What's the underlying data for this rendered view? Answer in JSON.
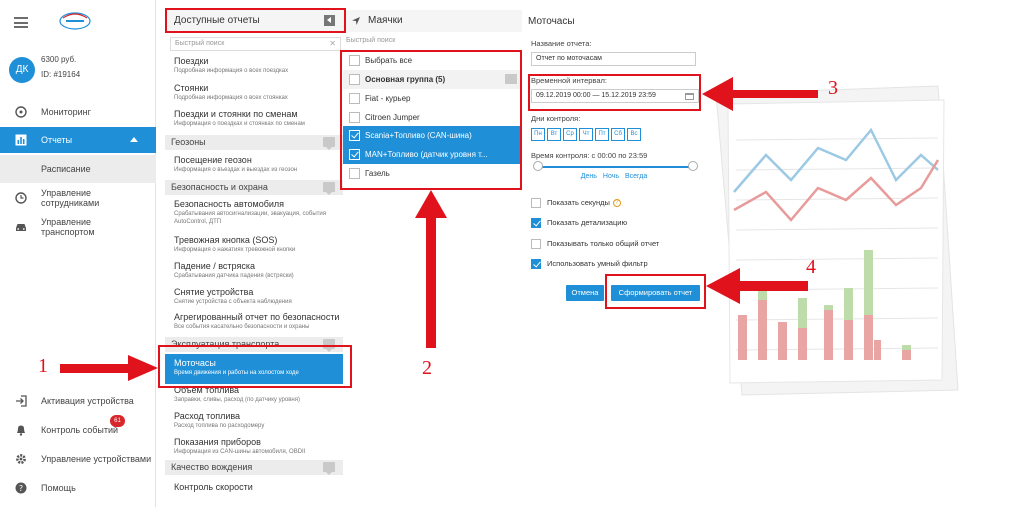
{
  "sidebar": {
    "balance": "6300 руб.",
    "account_id": "ID: #19164",
    "avatar": "ДК",
    "nav": {
      "monitoring": "Мониторинг",
      "reports": "Отчеты",
      "schedule": "Расписание",
      "employees": "Управление сотрудниками",
      "transport": "Управление транспортом",
      "activation": "Активация устройства",
      "events": "Контроль событий",
      "events_badge": "61",
      "devices": "Управление устройствами",
      "help": "Помощь"
    }
  },
  "reports": {
    "title": "Доступные отчеты",
    "search_placeholder": "Быстрый поиск",
    "items": [
      {
        "title": "Поездки",
        "desc": "Подробная информация о всех поездках"
      },
      {
        "title": "Стоянки",
        "desc": "Подробная информация о всех стоянках"
      },
      {
        "title": "Поездки и стоянки по сменам",
        "desc": "Информация о поездках и стоянках по сменам"
      },
      {
        "title": "Посещение геозон",
        "desc": "Информация о въездах и выездах из геозон"
      },
      {
        "title": "Безопасность автомобиля",
        "desc": "Срабатывания автосигнализации, эвакуация, события AutoControl, ДТП"
      },
      {
        "title": "Тревожная кнопка (SOS)",
        "desc": "Информация о нажатиях тревожной кнопки"
      },
      {
        "title": "Падение / встряска",
        "desc": "Срабатывания датчика падения (встряски)"
      },
      {
        "title": "Снятие устройства",
        "desc": "Снятие устройства с объекта наблюдения"
      },
      {
        "title": "Агрегированный отчет по безопасности",
        "desc": "Все события касательно безопасности и охраны"
      },
      {
        "title": "Моточасы",
        "desc": "Время движения и работы на холостом ходе"
      },
      {
        "title": "Объем топлива",
        "desc": "Заправки, сливы, расход (по датчику уровня)"
      },
      {
        "title": "Расход топлива",
        "desc": "Расход топлива по расходомеру"
      },
      {
        "title": "Показания приборов",
        "desc": "Информация из CAN-шины автомобиля, OBDII"
      },
      {
        "title": "Контроль скорости",
        "desc": ""
      }
    ],
    "sections": [
      "Геозоны",
      "Безопасность и охрана",
      "Эксплуатация транспорта",
      "Качество вождения"
    ]
  },
  "beacons": {
    "title": "Маячки",
    "search_placeholder": "Быстрый поиск",
    "rows": [
      {
        "label": "Выбрать все"
      },
      {
        "label": "Основная группа (5)"
      },
      {
        "label": "Fiat - курьер"
      },
      {
        "label": "Citroen Jumper"
      },
      {
        "label": "Scania+Топливо (CAN-шина)"
      },
      {
        "label": "MAN+Топливо (датчик уровня т..."
      },
      {
        "label": "Газель"
      }
    ]
  },
  "form": {
    "title": "Моточасы",
    "name_label": "Название отчета:",
    "name_value": "Отчет по моточасам",
    "interval_label": "Временной интервал:",
    "interval_value": "09.12.2019 00:00 — 15.12.2019 23:59",
    "days_label": "Дни контроля:",
    "days": [
      "Пн",
      "Вт",
      "Ср",
      "Чт",
      "Пт",
      "Сб",
      "Вс"
    ],
    "time_label": "Время контроля: с 00:00 по 23:59",
    "time_links": [
      "День",
      "Ночь",
      "Всегда"
    ],
    "options": [
      {
        "label": "Показать секунды",
        "checked": false
      },
      {
        "label": "Показать детализацию",
        "checked": true
      },
      {
        "label": "Показывать только общий отчет",
        "checked": false
      },
      {
        "label": "Использовать умный фильтр",
        "checked": true
      }
    ],
    "cancel": "Отмена",
    "submit": "Сформировать отчет"
  },
  "annotations": [
    "1",
    "2",
    "3",
    "4"
  ],
  "colors": {
    "accent": "#1f8fd8",
    "annotation": "#e0121b"
  }
}
